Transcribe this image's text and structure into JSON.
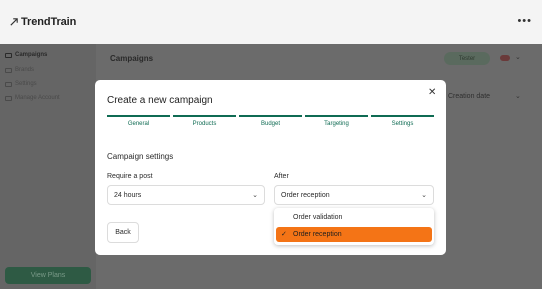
{
  "app": {
    "brand": "TrendTrain",
    "more_icon": "more-dots-icon"
  },
  "sidebar": {
    "items": [
      {
        "label": "Campaigns",
        "icon": "megaphone-icon",
        "active": true
      },
      {
        "label": "Brands",
        "icon": "tag-icon",
        "active": false
      },
      {
        "label": "Settings",
        "icon": "gear-icon",
        "active": false
      },
      {
        "label": "Manage Account",
        "icon": "user-icon",
        "active": false
      }
    ],
    "view_plans": "View Plans"
  },
  "main": {
    "title": "Campaigns",
    "tester_label": "Tester",
    "sort_label": "Creation date"
  },
  "modal": {
    "title": "Create a new campaign",
    "close_icon": "close-icon",
    "steps": [
      "General",
      "Products",
      "Budget",
      "Targeting",
      "Settings"
    ],
    "section_title": "Campaign settings",
    "require_post": {
      "label": "Require a post",
      "value": "24 hours"
    },
    "after": {
      "label": "After",
      "value": "Order reception"
    },
    "dropdown_options": [
      {
        "label": "Order validation",
        "selected": false
      },
      {
        "label": "Order reception",
        "selected": true
      }
    ],
    "back_label": "Back"
  },
  "colors": {
    "accent": "#0f6b53",
    "selected_option": "#f47416",
    "overlay": "#6b6b6b"
  }
}
